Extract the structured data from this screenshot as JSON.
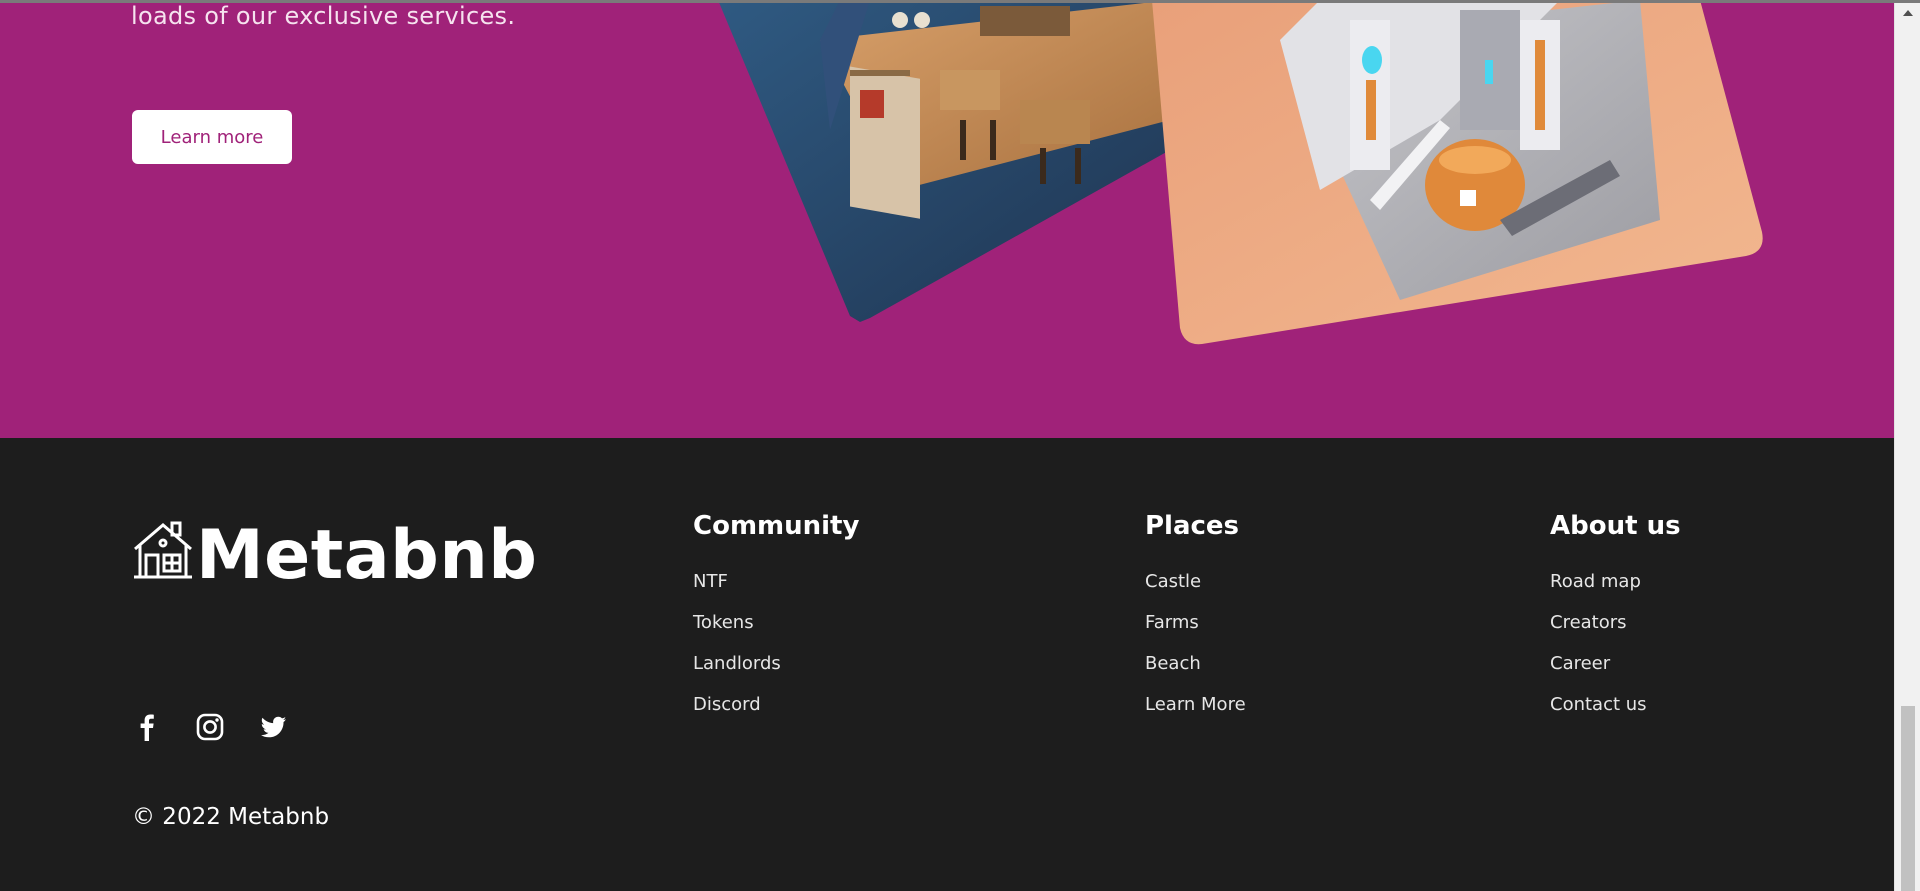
{
  "hero": {
    "text": "loads of our exclusive services.",
    "button_label": "Learn more",
    "background_color": "#a02279"
  },
  "footer": {
    "brand_name": "Metabnb",
    "brand_icon": "house-icon",
    "columns": [
      {
        "heading": "Community",
        "links": [
          "NTF",
          "Tokens",
          "Landlords",
          "Discord"
        ]
      },
      {
        "heading": "Places",
        "links": [
          "Castle",
          "Farms",
          "Beach",
          "Learn More"
        ]
      },
      {
        "heading": "About us",
        "links": [
          "Road map",
          "Creators",
          "Career",
          "Contact us"
        ]
      }
    ],
    "socials": [
      "facebook-icon",
      "instagram-icon",
      "twitter-icon"
    ],
    "copyright": "© 2022 Metabnb",
    "background_color": "#1d1d1d"
  }
}
